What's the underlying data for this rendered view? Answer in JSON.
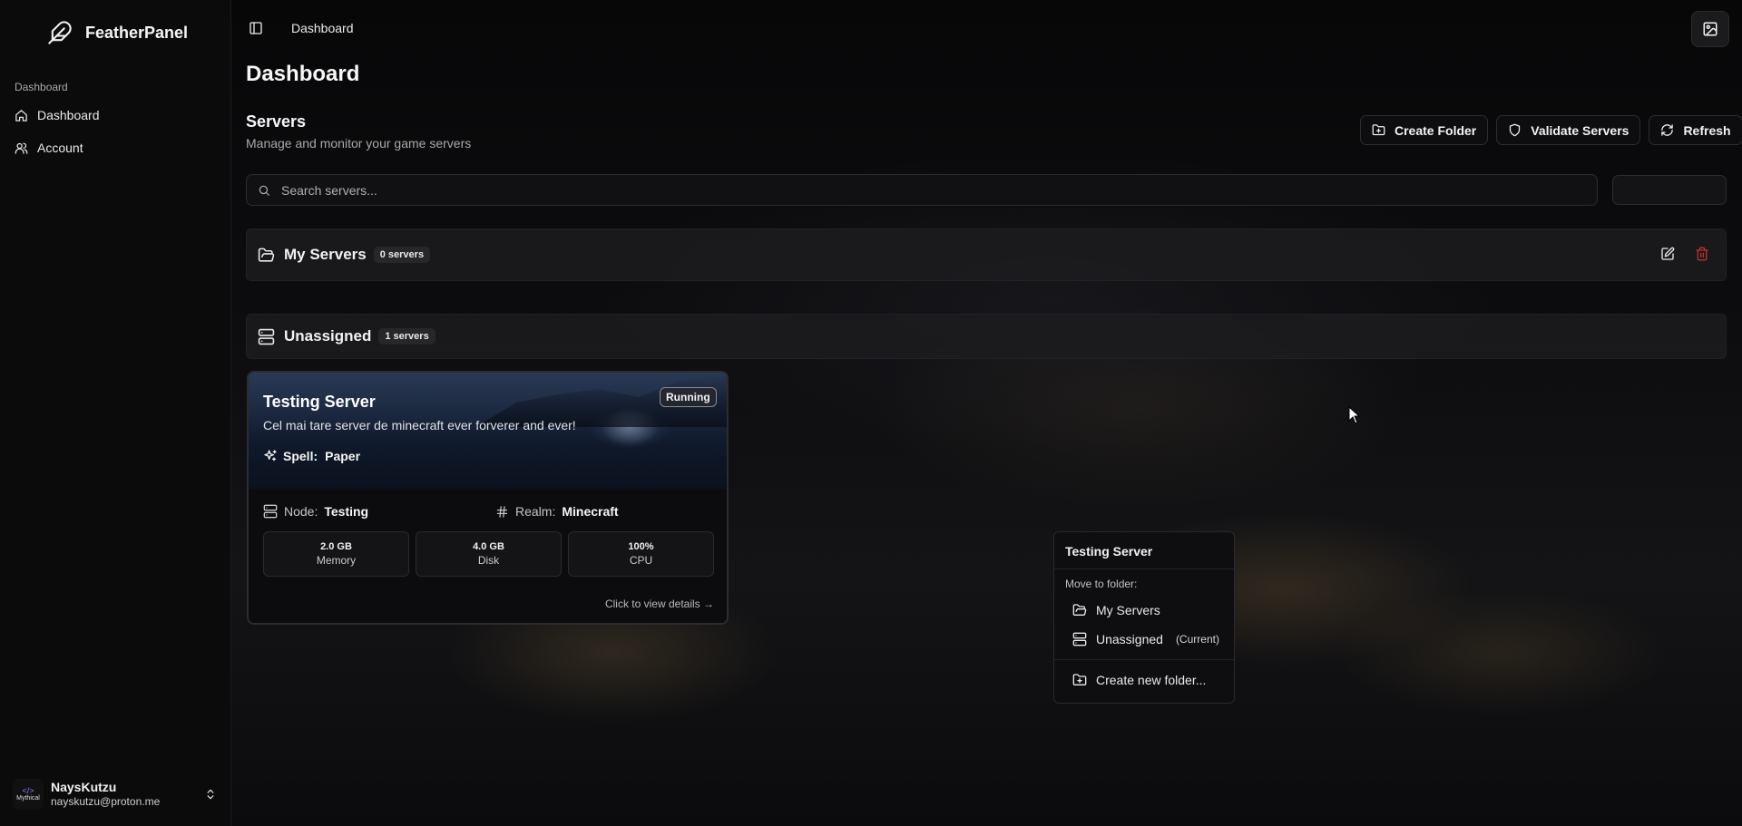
{
  "app": {
    "name": "FeatherPanel"
  },
  "sidebar": {
    "group_label": "Dashboard",
    "items": [
      {
        "label": "Dashboard",
        "icon": "home-icon"
      },
      {
        "label": "Account",
        "icon": "users-icon"
      }
    ],
    "user": {
      "avatar_text": "Mythical",
      "name": "NaysKutzu",
      "email": "nayskutzu@proton.me"
    }
  },
  "header": {
    "breadcrumb": "Dashboard"
  },
  "page": {
    "title": "Dashboard"
  },
  "servers_section": {
    "title": "Servers",
    "subtitle": "Manage and monitor your game servers",
    "actions": {
      "create_folder": "Create Folder",
      "validate_servers": "Validate Servers",
      "refresh": "Refresh"
    },
    "search": {
      "placeholder": "Search servers...",
      "value": ""
    }
  },
  "folders": [
    {
      "name": "My Servers",
      "count": "0 servers"
    },
    {
      "name": "Unassigned",
      "count": "1 servers"
    }
  ],
  "server_card": {
    "name": "Testing Server",
    "description": "Cel mai tare server de minecraft ever forverer and ever!",
    "status": "Running",
    "spell_label": "Spell:",
    "spell_value": "Paper",
    "node_label": "Node:",
    "node_value": "Testing",
    "realm_label": "Realm:",
    "realm_value": "Minecraft",
    "stats": [
      {
        "value": "2.0 GB",
        "label": "Memory"
      },
      {
        "value": "4.0 GB",
        "label": "Disk"
      },
      {
        "value": "100%",
        "label": "CPU"
      }
    ],
    "details_link": "Click to view details →"
  },
  "context_menu": {
    "title": "Testing Server",
    "subtitle": "Move to folder:",
    "items": [
      {
        "label": "My Servers",
        "note": ""
      },
      {
        "label": "Unassigned",
        "note": "(Current)"
      }
    ],
    "create_label": "Create new folder..."
  },
  "colors": {
    "background": "#060607",
    "sidebar": "#0b0b0c",
    "danger": "#c0302c",
    "text": "#f2f2f2"
  }
}
